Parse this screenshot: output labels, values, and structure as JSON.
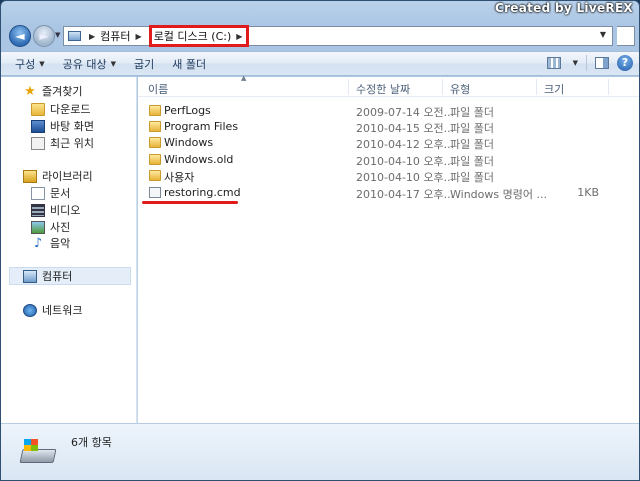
{
  "watermark": "Created by LiveREX",
  "breadcrumb": {
    "root": "컴퓨터",
    "current": "로컬 디스크 (C:)"
  },
  "toolbar": {
    "organize": "구성",
    "share": "공유 대상",
    "burn": "굽기",
    "new_folder": "새 폴더",
    "help": "?"
  },
  "nav": {
    "favorites": "즐겨찾기",
    "downloads": "다운로드",
    "desktop": "바탕 화면",
    "recent": "최근 위치",
    "libraries": "라이브러리",
    "documents": "문서",
    "videos": "비디오",
    "pictures": "사진",
    "music": "음악",
    "computer": "컴퓨터",
    "network": "네트워크"
  },
  "columns": {
    "name": "이름",
    "date": "수정한 날짜",
    "type": "유형",
    "size": "크기"
  },
  "files": [
    {
      "name": "PerfLogs",
      "date": "2009-07-14 오전...",
      "type": "파일 폴더",
      "size": "",
      "icon": "folder-icon"
    },
    {
      "name": "Program Files",
      "date": "2010-04-15 오전...",
      "type": "파일 폴더",
      "size": "",
      "icon": "folder-icon"
    },
    {
      "name": "Windows",
      "date": "2010-04-12 오후...",
      "type": "파일 폴더",
      "size": "",
      "icon": "folder-icon"
    },
    {
      "name": "Windows.old",
      "date": "2010-04-10 오후...",
      "type": "파일 폴더",
      "size": "",
      "icon": "folder-icon"
    },
    {
      "name": "사용자",
      "date": "2010-04-10 오후...",
      "type": "파일 폴더",
      "size": "",
      "icon": "folder-icon"
    },
    {
      "name": "restoring.cmd",
      "date": "2010-04-17 오후...",
      "type": "Windows 명령어 ...",
      "size": "1KB",
      "icon": "cmd-file-icon"
    }
  ],
  "status": {
    "item_count": "6개 항목"
  },
  "colors": {
    "highlight": "#e01b1b",
    "toolbar_text": "#1e395b"
  }
}
